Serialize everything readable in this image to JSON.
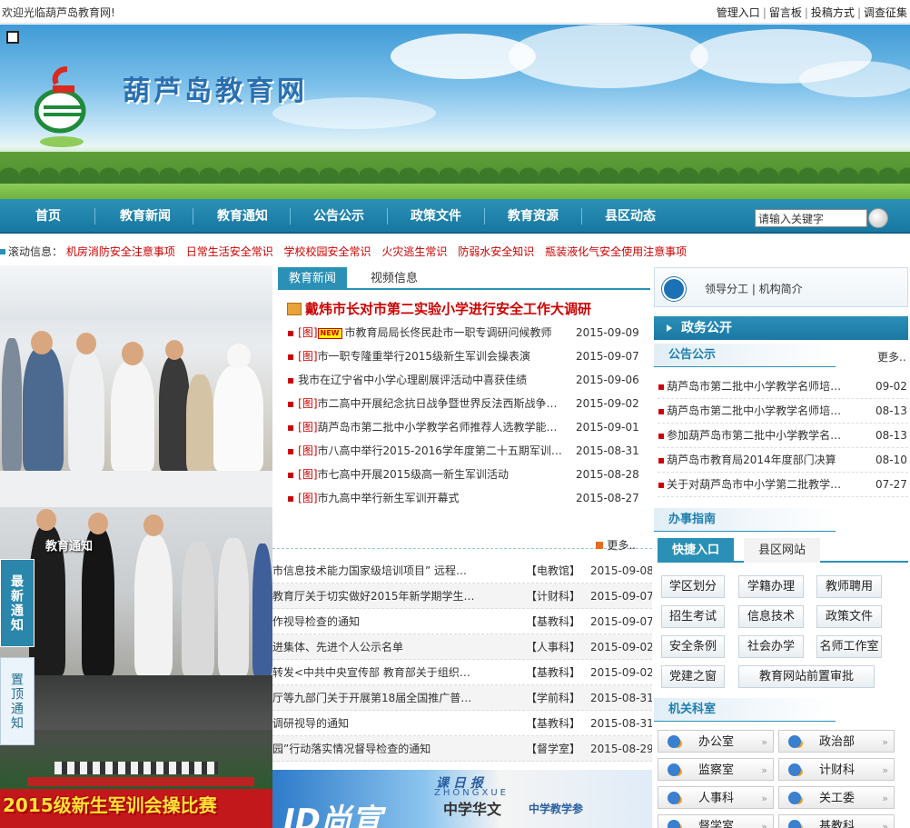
{
  "topbar": {
    "welcome": "欢迎光临葫芦岛教育网!",
    "links": [
      "管理入口",
      "留言板",
      "投稿方式",
      "调查征集"
    ]
  },
  "banner": {
    "title": "葫芦岛教育网"
  },
  "nav": {
    "items": [
      "首页",
      "教育新闻",
      "教育通知",
      "公告公示",
      "政策文件",
      "教育资源",
      "县区动态"
    ],
    "search_placeholder": "请输入关键字"
  },
  "scroll": {
    "label": "滚动信息：",
    "messages": [
      "机房消防安全注意事项",
      "日常生活安全常识",
      "学校校园安全常识",
      "火灾逃生常识",
      "防弱水安全知识",
      "瓶装液化气安全使用注意事项"
    ]
  },
  "photos": {
    "overlay_label": "教育通知",
    "side_tab_1": "最新通知",
    "side_tab_2": "置顶通知",
    "banner_text": "2015级新生军训会操比赛"
  },
  "news": {
    "tabs": [
      "教育新闻",
      "视频信息"
    ],
    "headline": "戴炜市长对市第二实验小学进行安全工作大调研",
    "items": [
      {
        "tag": "[图]",
        "new": "NEW",
        "title": "市教育局局长佟民赴市一职专调研问候教师",
        "date": "2015-09-09"
      },
      {
        "tag": "[图]",
        "new": "",
        "title": "市一职专隆重举行2015级新生军训会操表演",
        "date": "2015-09-07"
      },
      {
        "tag": "",
        "new": "",
        "title": "我市在辽宁省中小学心理剧展评活动中喜获佳绩",
        "date": "2015-09-06"
      },
      {
        "tag": "[图]",
        "new": "",
        "title": "市二高中开展纪念抗日战争暨世界反法西斯战争…",
        "date": "2015-09-02"
      },
      {
        "tag": "[图]",
        "new": "",
        "title": "葫芦岛市第二批中小学教学名师推荐人选教学能…",
        "date": "2015-09-01"
      },
      {
        "tag": "[图]",
        "new": "",
        "title": "市八高中举行2015-2016学年度第二十五期军训…",
        "date": "2015-08-31"
      },
      {
        "tag": "[图]",
        "new": "",
        "title": "市七高中开展2015级高一新生军训活动",
        "date": "2015-08-28"
      },
      {
        "tag": "[图]",
        "new": "",
        "title": "市九高中举行新生军训开幕式",
        "date": "2015-08-27"
      }
    ]
  },
  "notices": {
    "more": "更多..",
    "items": [
      {
        "title": "市信息技术能力国家级培训项目” 远程…",
        "dept": "【电教馆】",
        "date": "2015-09-08"
      },
      {
        "title": "教育厅关于切实做好2015年新学期学生…",
        "dept": "【计财科】",
        "date": "2015-09-07"
      },
      {
        "title": "作视导检查的通知",
        "dept": "【基教科】",
        "date": "2015-09-07"
      },
      {
        "title": "进集体、先进个人公示名单",
        "dept": "【人事科】",
        "date": "2015-09-02"
      },
      {
        "title": "转发<中共中央宣传部 教育部关于组织…",
        "dept": "【基教科】",
        "date": "2015-09-02"
      },
      {
        "title": "厅等九部门关于开展第18届全国推广普…",
        "dept": "【学前科】",
        "date": "2015-08-31"
      },
      {
        "title": "调研视导的通知",
        "dept": "【基教科】",
        "date": "2015-08-31"
      },
      {
        "title": "园”行动落实情况督导检查的通知",
        "dept": "【督学室】",
        "date": "2015-08-29"
      }
    ]
  },
  "magazine": {
    "t1": "课 日 报",
    "t2": "ZHONGXUE",
    "t3": "中学华文",
    "t4": "中学教学参",
    "t5": "ID尚宣"
  },
  "right": {
    "leader_text": "领导分工 | 机构简介",
    "gov_title": "政务公开",
    "announce_title": "公告公示",
    "announce_more": "更多..",
    "announcements": [
      {
        "title": "葫芦岛市第二批中小学教学名师培…",
        "date": "09-02"
      },
      {
        "title": "葫芦岛市第二批中小学教学名师培…",
        "date": "08-13"
      },
      {
        "title": "参加葫芦岛市第二批中小学教学名…",
        "date": "08-13"
      },
      {
        "title": "葫芦岛市教育局2014年度部门决算",
        "date": "08-10"
      },
      {
        "title": "关于对葫芦岛市中小学第二批教学…",
        "date": "07-27"
      }
    ],
    "guide_title": "办事指南",
    "guide_tabs": [
      "快捷入口",
      "县区网站"
    ],
    "guide_buttons": [
      "学区划分",
      "学籍办理",
      "教师聘用",
      "招生考试",
      "信息技术",
      "政策文件",
      "安全条例",
      "社会办学",
      "名师工作室",
      "党建之窗",
      "教育网站前置审批"
    ],
    "dept_title": "机关科室",
    "depts": [
      "办公室",
      "政治部",
      "监察室",
      "计财科",
      "人事科",
      "关工委",
      "督学室",
      "基教科"
    ]
  },
  "colors": {
    "nav": "#1f86b0",
    "accent_red": "#cc0000",
    "link_blue": "#2a6fb0"
  }
}
